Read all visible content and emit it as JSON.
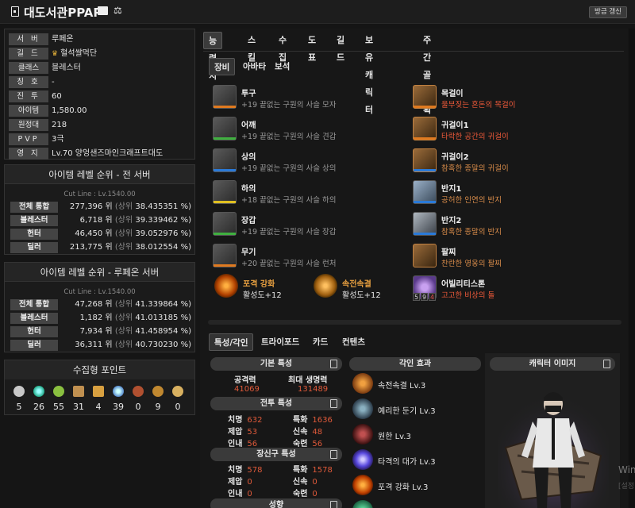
{
  "header": {
    "title": "대도서관PPAP",
    "refresh_label": "방금 갱신"
  },
  "info": {
    "rows": [
      {
        "label": "서 버",
        "value": "루페온"
      },
      {
        "label": "길 드",
        "value": "혈석쌀먹단"
      },
      {
        "label": "클래스",
        "value": "블레스터"
      },
      {
        "label": "칭 호",
        "value": "-"
      },
      {
        "label": "진 투",
        "value": "60"
      },
      {
        "label": "아이템",
        "value": "1,580.00"
      },
      {
        "label": "원정대",
        "value": "218"
      },
      {
        "label": "PVP",
        "value": "3극"
      },
      {
        "label": "영 지",
        "value": "Lv.70 양엉샌즈마인크래프트대도"
      }
    ]
  },
  "rank_all": {
    "title": "아이템 레벨 순위 - 전 서버",
    "cut": "Cut Line : Lv.1540.00",
    "rows": [
      {
        "label": "전체 통합",
        "rank": "277,396 위",
        "pct_label": "(상위",
        "pct": "38.435351 %)"
      },
      {
        "label": "블레스터",
        "rank": "6,718 위",
        "pct_label": "(상위",
        "pct": "39.339462 %)"
      },
      {
        "label": "헌터",
        "rank": "46,450 위",
        "pct_label": "(상위",
        "pct": "39.052976 %)"
      },
      {
        "label": "딜러",
        "rank": "213,775 위",
        "pct_label": "(상위",
        "pct": "38.012554 %)"
      }
    ]
  },
  "rank_server": {
    "title": "아이템 레벨 순위 - 루페온 서버",
    "cut": "Cut Line : Lv.1540.00",
    "rows": [
      {
        "label": "전체 통합",
        "rank": "47,268 위",
        "pct_label": "(상위",
        "pct": "41.339864 %)"
      },
      {
        "label": "블레스터",
        "rank": "1,182 위",
        "pct_label": "(상위",
        "pct": "41.013185 %)"
      },
      {
        "label": "헌터",
        "rank": "7,934 위",
        "pct_label": "(상위",
        "pct": "41.458954 %)"
      },
      {
        "label": "딜러",
        "rank": "36,311 위",
        "pct_label": "(상위",
        "pct": "40.730230 %)"
      }
    ]
  },
  "collect": {
    "title": "수집형 포인트",
    "items": [
      {
        "icon": "island-heart-icon",
        "count": "5"
      },
      {
        "icon": "orpheus-star-icon",
        "count": "26"
      },
      {
        "icon": "mokoko-seed-icon",
        "count": "55"
      },
      {
        "icon": "art-icon",
        "count": "31"
      },
      {
        "icon": "voyage-icon",
        "count": "4"
      },
      {
        "icon": "giant-heart-icon",
        "count": "39"
      },
      {
        "icon": "ignea-token-icon",
        "count": "0"
      },
      {
        "icon": "world-tree-leaf-icon",
        "count": "9"
      },
      {
        "icon": "sailing-coin-icon",
        "count": "0"
      }
    ]
  },
  "main_tabs": [
    "능력치",
    "스킬",
    "수집",
    "도표",
    "길드",
    "보유 캐릭터",
    "주간골드획득"
  ],
  "equip_tabs": [
    "장비",
    "아바타",
    "보석"
  ],
  "equipment": [
    {
      "name": "투구",
      "desc": "+19 끝없는 구원의 사슬 모자",
      "bar": "#e07a20"
    },
    {
      "name": "어깨",
      "desc": "+19 끝없는 구원의 사슬 견갑",
      "bar": "#40b040"
    },
    {
      "name": "상의",
      "desc": "+19 끝없는 구원의 사슬 상의",
      "bar": "#2a7ad8"
    },
    {
      "name": "하의",
      "desc": "+18 끝없는 구원의 사슬 하의",
      "bar": "#e0c020"
    },
    {
      "name": "장갑",
      "desc": "+19 끝없는 구원의 사슬 장갑",
      "bar": "#40b040"
    },
    {
      "name": "무기",
      "desc": "+20 끝없는 구원의 사슬 런처",
      "bar": "#e07a20"
    }
  ],
  "accessories": [
    {
      "name": "목걸이",
      "desc": "울부짖는 혼돈의 목걸이",
      "style": "red",
      "bar": "#e07a20"
    },
    {
      "name": "귀걸이1",
      "desc": "타락한 공간의 귀걸이",
      "style": "red",
      "bar": "#e07a20"
    },
    {
      "name": "귀걸이2",
      "desc": "참혹한 종말의 귀걸이",
      "style": "orng",
      "bar": "#2a7ad8"
    },
    {
      "name": "반지1",
      "desc": "공허한 인연의 반지",
      "style": "orng",
      "bar": "#2a7ad8"
    },
    {
      "name": "반지2",
      "desc": "참혹한 종말의 반지",
      "style": "orng",
      "bar": "#2a7ad8"
    },
    {
      "name": "팔찌",
      "desc": "찬란한 영웅의 팔찌",
      "style": "orng",
      "bar": ""
    },
    {
      "name": "어빌리티스톤",
      "desc": "고고한 비상의 돌",
      "style": "red",
      "bar": "",
      "nums": [
        "5",
        "9",
        "4"
      ]
    }
  ],
  "bracelets": [
    {
      "title": "포격 강화",
      "value": "활성도+12"
    },
    {
      "title": "속전속결",
      "value": "활성도+12"
    }
  ],
  "lower_tabs": [
    "특성/각인",
    "트라이포드",
    "카드",
    "컨텐츠"
  ],
  "basic_stats": {
    "title": "기본 특성",
    "atk_label": "공격력",
    "atk": "41069",
    "hp_label": "최대 생명력",
    "hp": "131489"
  },
  "battle_stats": {
    "title": "전투 특성",
    "items": [
      {
        "k": "치명",
        "v": "632"
      },
      {
        "k": "특화",
        "v": "1636"
      },
      {
        "k": "제압",
        "v": "53"
      },
      {
        "k": "신속",
        "v": "48"
      },
      {
        "k": "인내",
        "v": "56"
      },
      {
        "k": "숙련",
        "v": "56"
      }
    ]
  },
  "gear_stats": {
    "title": "장신구 특성",
    "items": [
      {
        "k": "치명",
        "v": "578"
      },
      {
        "k": "특화",
        "v": "1578"
      },
      {
        "k": "제압",
        "v": "0"
      },
      {
        "k": "신속",
        "v": "0"
      },
      {
        "k": "인내",
        "v": "0"
      },
      {
        "k": "숙련",
        "v": "0"
      }
    ]
  },
  "tendency": {
    "title": "성향"
  },
  "engravings": {
    "title": "각인 효과",
    "items": [
      {
        "name": "속전속결 Lv.3",
        "color": "#d8741a"
      },
      {
        "name": "예리한 둔기 Lv.3",
        "color": "#5a7a8a"
      },
      {
        "name": "원한 Lv.3",
        "color": "#8a2a2a"
      },
      {
        "name": "타격의 대가 Lv.3",
        "color": "#6a6ae0"
      },
      {
        "name": "포격 강화 Lv.3",
        "color": "#e07a20"
      }
    ]
  },
  "character_image": {
    "title": "캐릭터 이미지"
  },
  "watermark": {
    "line1": "Win",
    "line2": "[설정"
  }
}
